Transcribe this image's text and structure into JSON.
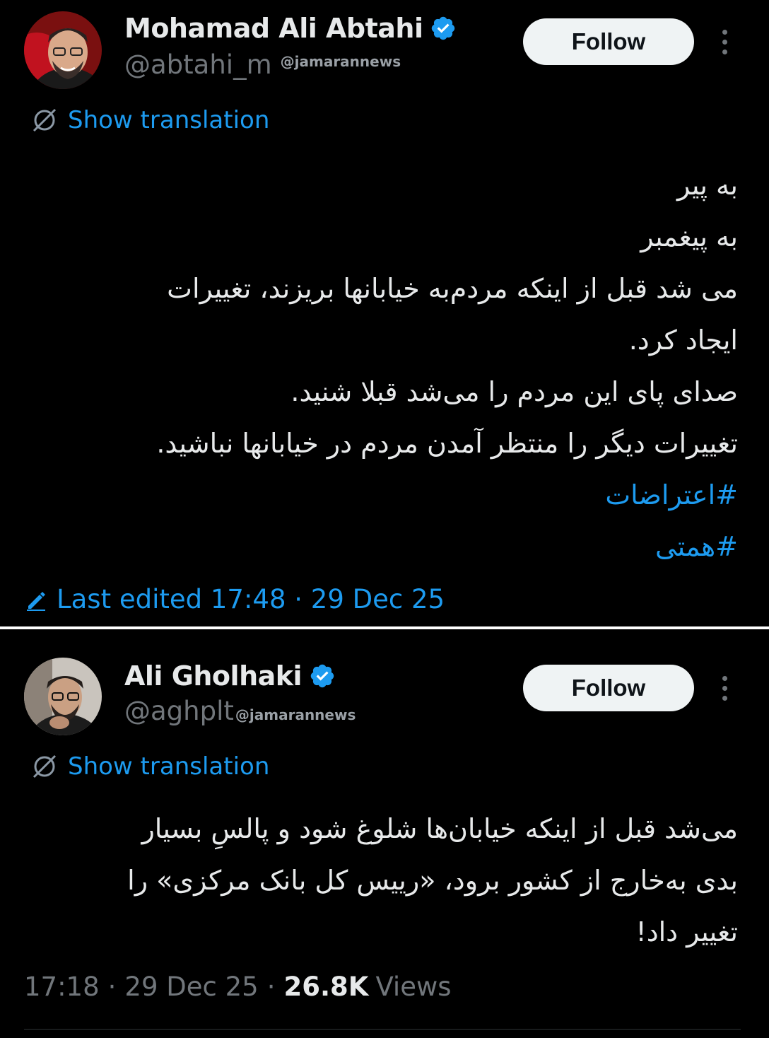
{
  "tweets": [
    {
      "author_name": "Mohamad Ali Abtahi",
      "handle": "@abtahi_m",
      "watermark": "@jamarannews",
      "follow_label": "Follow",
      "show_translation": "Show translation",
      "body_lines": [
        "به پیر",
        "به پیغمبر",
        "می شد قبل از اینکه مردم‌به خیابانها بریزند، تغییرات",
        "ایجاد کرد.",
        "صدای پای این مردم را می‌شد قبلا شنید.",
        "تغییرات دیگر را منتظر آمدن مردم در خیابانها نباشید."
      ],
      "hashtags": [
        "#اعتراضات",
        "#همتی"
      ],
      "last_edited": "Last edited 17:48 · 29 Dec 25"
    },
    {
      "author_name": "Ali Gholhaki",
      "handle": "@aghplt",
      "watermark": "@jamarannews",
      "follow_label": "Follow",
      "show_translation": "Show translation",
      "body_lines": [
        "می‌شد قبل از اینکه خیابان‌ها شلوغ شود و پالسِ بسیار",
        "بدی به‌خارج از کشور برود، «رییس کل بانک مرکزی» را",
        "تغییر داد!"
      ],
      "time": "17:18",
      "date": "29 Dec 25",
      "views_count": "26.8K",
      "views_label": "Views"
    }
  ],
  "colors": {
    "background": "#000000",
    "accent": "#1d9bf0",
    "text": "#e7e9ea",
    "muted": "#71767b",
    "follow_bg": "#eff3f4"
  },
  "icons": [
    "verified-badge-icon",
    "translate-icon",
    "more-icon",
    "edit-pencil-icon"
  ]
}
